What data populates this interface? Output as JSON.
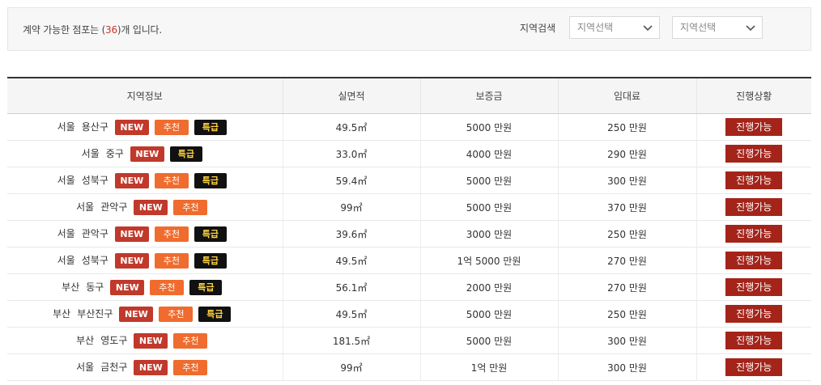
{
  "summary": {
    "prefix": "계약 가능한 점포는 (",
    "count": "36",
    "suffix": ")개 입니다."
  },
  "search": {
    "label": "지역검색",
    "select1": "지역선택",
    "select2": "지역선택"
  },
  "headers": [
    "지역정보",
    "실면적",
    "보증금",
    "임대료",
    "진행상황"
  ],
  "badge_labels": {
    "new": "NEW",
    "recommend": "추천",
    "special": "특급"
  },
  "rows": [
    {
      "city": "서울",
      "district": "용산구",
      "badges": [
        "new",
        "recommend",
        "special"
      ],
      "area": "49.5㎡",
      "deposit": "5000 만원",
      "rent": "250 만원",
      "status": "진행가능"
    },
    {
      "city": "서울",
      "district": "중구",
      "badges": [
        "new",
        "special"
      ],
      "area": "33.0㎡",
      "deposit": "4000 만원",
      "rent": "290 만원",
      "status": "진행가능"
    },
    {
      "city": "서울",
      "district": "성북구",
      "badges": [
        "new",
        "recommend",
        "special"
      ],
      "area": "59.4㎡",
      "deposit": "5000 만원",
      "rent": "300 만원",
      "status": "진행가능"
    },
    {
      "city": "서울",
      "district": "관악구",
      "badges": [
        "new",
        "recommend"
      ],
      "area": "99㎡",
      "deposit": "5000 만원",
      "rent": "370 만원",
      "status": "진행가능"
    },
    {
      "city": "서울",
      "district": "관악구",
      "badges": [
        "new",
        "recommend",
        "special"
      ],
      "area": "39.6㎡",
      "deposit": "3000 만원",
      "rent": "250 만원",
      "status": "진행가능"
    },
    {
      "city": "서울",
      "district": "성북구",
      "badges": [
        "new",
        "recommend",
        "special"
      ],
      "area": "49.5㎡",
      "deposit": "1억 5000 만원",
      "rent": "270 만원",
      "status": "진행가능"
    },
    {
      "city": "부산",
      "district": "동구",
      "badges": [
        "new",
        "recommend",
        "special"
      ],
      "area": "56.1㎡",
      "deposit": "2000 만원",
      "rent": "270 만원",
      "status": "진행가능"
    },
    {
      "city": "부산",
      "district": "부산진구",
      "badges": [
        "new",
        "recommend",
        "special"
      ],
      "area": "49.5㎡",
      "deposit": "5000 만원",
      "rent": "250 만원",
      "status": "진행가능"
    },
    {
      "city": "부산",
      "district": "영도구",
      "badges": [
        "new",
        "recommend"
      ],
      "area": "181.5㎡",
      "deposit": "5000 만원",
      "rent": "300 만원",
      "status": "진행가능"
    },
    {
      "city": "서울",
      "district": "금천구",
      "badges": [
        "new",
        "recommend"
      ],
      "area": "99㎡",
      "deposit": "1억 만원",
      "rent": "300 만원",
      "status": "진행가능"
    }
  ]
}
